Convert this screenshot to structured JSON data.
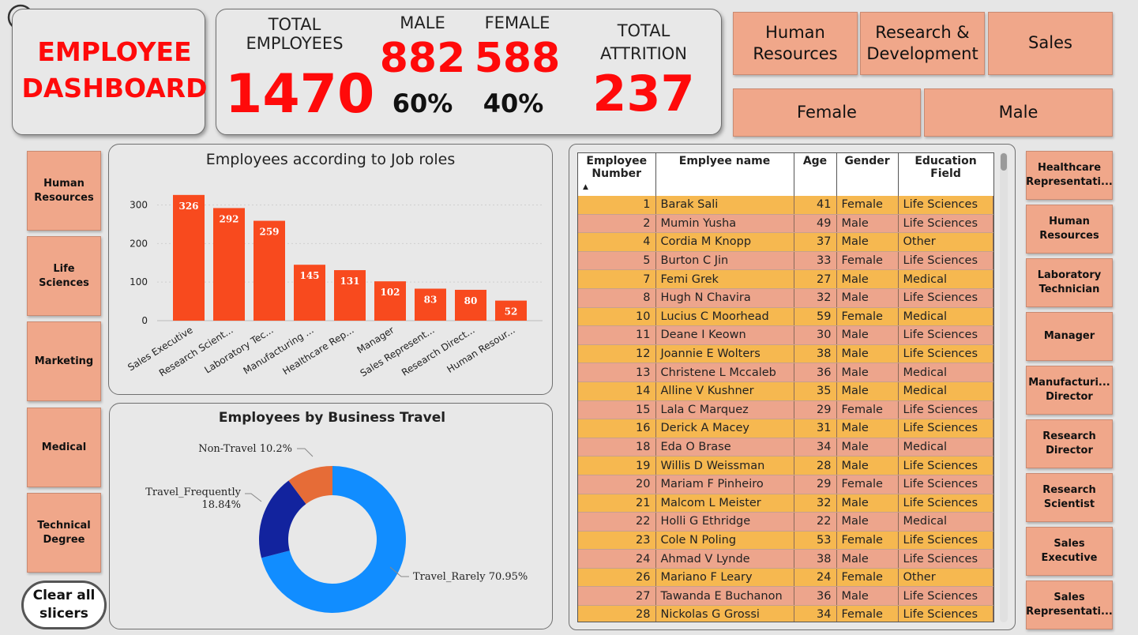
{
  "title": [
    "EMPLOYEE",
    "DASHBOARD"
  ],
  "kpi": {
    "total_label": [
      "TOTAL",
      "EMPLOYEES"
    ],
    "total_value": "1470",
    "male_label": "MALE",
    "male_value": "882",
    "male_pct": "60%",
    "female_label": "FEMALE",
    "female_value": "588",
    "female_pct": "40%",
    "attrition_label": [
      "TOTAL",
      "ATTRITION"
    ],
    "attrition_value": "237"
  },
  "top_slicers": {
    "departments": [
      [
        "Human",
        "Resources"
      ],
      [
        "Research &",
        "Development"
      ],
      [
        "Sales"
      ]
    ],
    "gender": [
      "Female",
      "Male"
    ]
  },
  "left_slicers": [
    [
      "Human",
      "Resources"
    ],
    [
      "Life",
      "Sciences"
    ],
    [
      "Marketing"
    ],
    [
      "Medical"
    ],
    [
      "Technical",
      "Degree"
    ]
  ],
  "clear_button": [
    "Clear all",
    "slicers"
  ],
  "right_slicers": [
    [
      "Healthcare",
      "Representati..."
    ],
    [
      "Human",
      "Resources"
    ],
    [
      "Laboratory",
      "Technician"
    ],
    [
      "Manager"
    ],
    [
      "Manufacturi...",
      "Director"
    ],
    [
      "Research",
      "Director"
    ],
    [
      "Research",
      "Scientist"
    ],
    [
      "Sales",
      "Executive"
    ],
    [
      "Sales",
      "Representati..."
    ]
  ],
  "bar_chart": {
    "chart_data": {
      "type": "bar",
      "title": "Employees according to Job roles",
      "categories": [
        "Sales Executive",
        "Research Scient...",
        "Laboratory Tec...",
        "Manufacturing ...",
        "Healthcare Rep...",
        "Manager",
        "Sales Represent...",
        "Research Direct...",
        "Human Resour..."
      ],
      "values": [
        326,
        292,
        259,
        145,
        131,
        102,
        83,
        80,
        52
      ],
      "yticks": [
        0,
        100,
        200,
        300
      ],
      "ylim": [
        0,
        340
      ],
      "color": "#f84a1e"
    }
  },
  "donut_chart": {
    "chart_data": {
      "type": "pie",
      "title": "Employees by Business Travel",
      "slices": [
        {
          "label": "Travel_Rarely 70.95%",
          "value": 70.95,
          "color": "#118dff"
        },
        {
          "label": "Travel_Frequently 18.84%",
          "value": 18.84,
          "color": "#12239e"
        },
        {
          "label": "Non-Travel 10.2%",
          "value": 10.2,
          "color": "#e66c37"
        }
      ]
    }
  },
  "table": {
    "headers": [
      [
        "Employee",
        "Number"
      ],
      [
        "Emplyee name"
      ],
      [
        "Age"
      ],
      [
        "Gender"
      ],
      [
        "Education Field"
      ]
    ],
    "rows": [
      [
        "1",
        "Barak Sali",
        "41",
        "Female",
        "Life Sciences"
      ],
      [
        "2",
        "Mumin Yusha",
        "49",
        "Male",
        "Life Sciences"
      ],
      [
        "4",
        "Cordia M Knopp",
        "37",
        "Male",
        "Other"
      ],
      [
        "5",
        "Burton C Jin",
        "33",
        "Female",
        "Life Sciences"
      ],
      [
        "7",
        "Femi Grek",
        "27",
        "Male",
        "Medical"
      ],
      [
        "8",
        "Hugh N Chavira",
        "32",
        "Male",
        "Life Sciences"
      ],
      [
        "10",
        "Lucius C Moorhead",
        "59",
        "Female",
        "Medical"
      ],
      [
        "11",
        "Deane I Keown",
        "30",
        "Male",
        "Life Sciences"
      ],
      [
        "12",
        "Joannie E Wolters",
        "38",
        "Male",
        "Life Sciences"
      ],
      [
        "13",
        "Christene L Mccaleb",
        "36",
        "Male",
        "Medical"
      ],
      [
        "14",
        "Alline V Kushner",
        "35",
        "Male",
        "Medical"
      ],
      [
        "15",
        "Lala C Marquez",
        "29",
        "Female",
        "Life Sciences"
      ],
      [
        "16",
        "Derick A Macey",
        "31",
        "Male",
        "Life Sciences"
      ],
      [
        "18",
        "Eda O Brase",
        "34",
        "Male",
        "Medical"
      ],
      [
        "19",
        "Willis D Weissman",
        "28",
        "Male",
        "Life Sciences"
      ],
      [
        "20",
        "Mariam F Pinheiro",
        "29",
        "Female",
        "Life Sciences"
      ],
      [
        "21",
        "Malcom L Meister",
        "32",
        "Male",
        "Life Sciences"
      ],
      [
        "22",
        "Holli G Ethridge",
        "22",
        "Male",
        "Medical"
      ],
      [
        "23",
        "Cole N Poling",
        "53",
        "Female",
        "Life Sciences"
      ],
      [
        "24",
        "Ahmad V Lynde",
        "38",
        "Male",
        "Life Sciences"
      ],
      [
        "26",
        "Mariano F Leary",
        "24",
        "Female",
        "Other"
      ],
      [
        "27",
        "Tawanda E Buchanon",
        "36",
        "Male",
        "Life Sciences"
      ],
      [
        "28",
        "Nickolas G Grossi",
        "34",
        "Female",
        "Life Sciences"
      ]
    ]
  }
}
